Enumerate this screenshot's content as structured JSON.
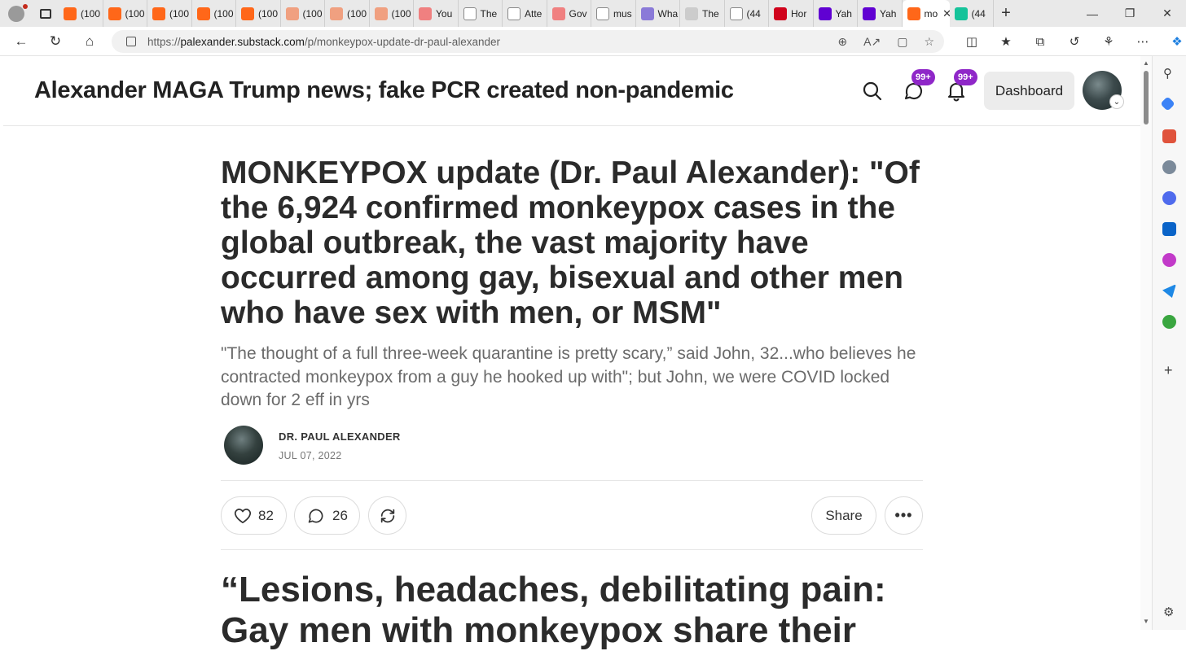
{
  "browser": {
    "tabs": [
      {
        "label": "(100",
        "favicon_color": "#ff6719",
        "icon": "substack-icon"
      },
      {
        "label": "(100",
        "favicon_color": "#ff6719",
        "icon": "substack-icon"
      },
      {
        "label": "(100",
        "favicon_color": "#ff6719",
        "icon": "substack-icon"
      },
      {
        "label": "(100",
        "favicon_color": "#ff6719",
        "icon": "substack-icon"
      },
      {
        "label": "(100",
        "favicon_color": "#ff6719",
        "icon": "substack-icon"
      },
      {
        "label": "(100",
        "favicon_color": "#f0a080",
        "icon": "substack-icon"
      },
      {
        "label": "(100",
        "favicon_color": "#f0a080",
        "icon": "substack-icon"
      },
      {
        "label": "(100",
        "favicon_color": "#f0a080",
        "icon": "substack-icon"
      },
      {
        "label": "You",
        "favicon_color": "#f08080",
        "icon": "youtube-icon"
      },
      {
        "label": "The",
        "favicon_color": "#ffffff",
        "icon": "page-icon"
      },
      {
        "label": "Atte",
        "favicon_color": "#ffffff",
        "icon": "page-icon"
      },
      {
        "label": "Gov",
        "favicon_color": "#f08080",
        "icon": "youtube-icon"
      },
      {
        "label": "mus",
        "favicon_color": "#ffffff",
        "icon": "page-icon"
      },
      {
        "label": "Wha",
        "favicon_color": "#8a7ad8",
        "icon": "shield-icon"
      },
      {
        "label": "The",
        "favicon_color": "#cccccc",
        "icon": "dots-icon"
      },
      {
        "label": "(44",
        "favicon_color": "#ffffff",
        "icon": "page-icon"
      },
      {
        "label": "Hor",
        "favicon_color": "#d0021b",
        "icon": "news-icon"
      },
      {
        "label": "Yah",
        "favicon_color": "#6001d2",
        "icon": "yahoo-icon"
      },
      {
        "label": "Yah",
        "favicon_color": "#6001d2",
        "icon": "yahoo-icon"
      },
      {
        "label": "mo",
        "favicon_color": "#ff6719",
        "icon": "substack-icon",
        "active": true
      },
      {
        "label": "(44",
        "favicon_color": "#15c39a",
        "icon": "grammarly-icon"
      }
    ],
    "url_scheme": "https://",
    "url_host": "palexander.substack.com",
    "url_path": "/p/monkeypox-update-dr-paul-alexander"
  },
  "site": {
    "title": "Alexander MAGA Trump news; fake PCR created non-pandemic",
    "chat_badge": "99+",
    "notification_badge": "99+",
    "dashboard_label": "Dashboard",
    "accent_color": "#8f27c8"
  },
  "post": {
    "title": "MONKEYPOX update (Dr. Paul Alexander): \"Of the 6,924 confirmed monkeypox cases in the global outbreak, the vast majority have occurred among gay, bisexual and other men who have sex with men, or MSM\"",
    "subtitle": "\"The thought of a full three-week quarantine is pretty scary,” said John, 32...who believes he contracted monkeypox from a guy he hooked up with\"; but John, we were COVID locked down for 2 eff in yrs",
    "author": "DR. PAUL ALEXANDER",
    "date": "JUL 07, 2022",
    "likes": "82",
    "comments": "26",
    "share_label": "Share",
    "section_heading": "“Lesions, headaches, debilitating pain: Gay men with monkeypox share their"
  }
}
